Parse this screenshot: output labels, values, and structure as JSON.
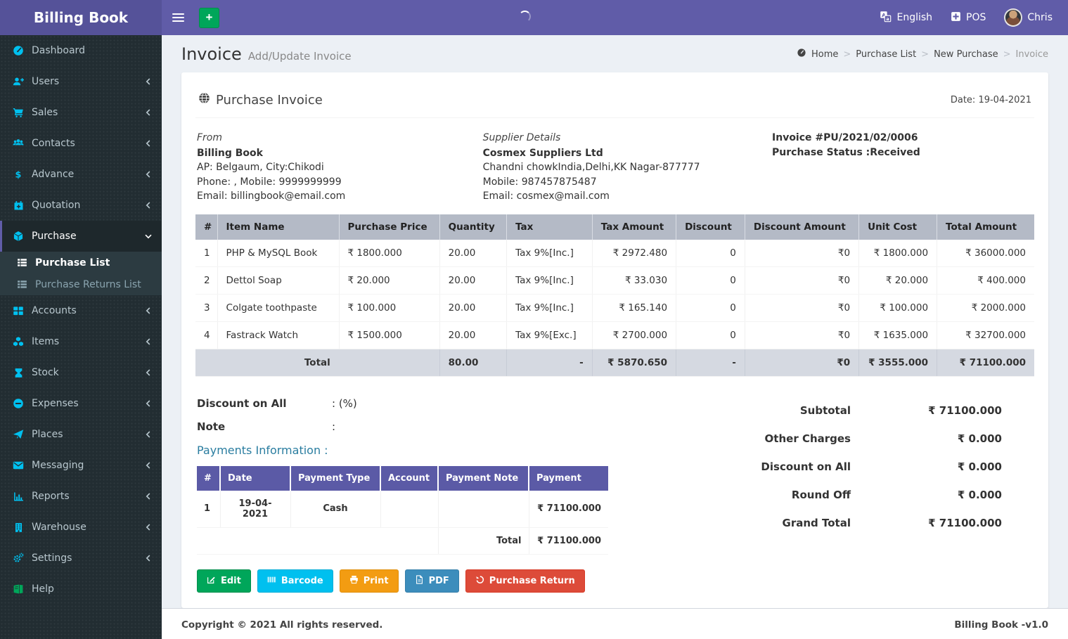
{
  "app": {
    "name": "Billing Book",
    "version": "Billing Book -v1.0",
    "copyright": "Copyright © 2021 All rights reserved."
  },
  "topbar": {
    "add_button": "+",
    "language": "English",
    "pos": "POS",
    "user": "Chris"
  },
  "sidebar": {
    "items": [
      {
        "label": "Dashboard",
        "icon": "dashboard-gauge-icon"
      },
      {
        "label": "Users",
        "icon": "user-plus-icon",
        "chevron": "left"
      },
      {
        "label": "Sales",
        "icon": "cart-icon",
        "chevron": "left"
      },
      {
        "label": "Contacts",
        "icon": "contacts-group-icon",
        "chevron": "left"
      },
      {
        "label": "Advance",
        "icon": "dollar-icon",
        "chevron": "left"
      },
      {
        "label": "Quotation",
        "icon": "calendar-plus-icon",
        "chevron": "left"
      },
      {
        "label": "Purchase",
        "icon": "cube-icon",
        "chevron": "down",
        "active": true
      },
      {
        "label": "Accounts",
        "icon": "grid-icon",
        "chevron": "left"
      },
      {
        "label": "Items",
        "icon": "cubes-icon",
        "chevron": "left"
      },
      {
        "label": "Stock",
        "icon": "hourglass-icon",
        "chevron": "left"
      },
      {
        "label": "Expenses",
        "icon": "minus-circle-icon",
        "chevron": "left"
      },
      {
        "label": "Places",
        "icon": "paper-plane-icon",
        "chevron": "left"
      },
      {
        "label": "Messaging",
        "icon": "envelope-icon",
        "chevron": "left"
      },
      {
        "label": "Reports",
        "icon": "bar-chart-icon",
        "chevron": "left"
      },
      {
        "label": "Warehouse",
        "icon": "building-icon",
        "chevron": "left"
      },
      {
        "label": "Settings",
        "icon": "gears-icon",
        "chevron": "left"
      },
      {
        "label": "Help",
        "icon": "help-books-icon"
      }
    ],
    "purchase_submenu": [
      {
        "label": "Purchase List",
        "icon": "list-icon",
        "active": true
      },
      {
        "label": "Purchase Returns List",
        "icon": "list-icon",
        "active": false
      }
    ]
  },
  "page": {
    "title": "Invoice",
    "subtitle": "Add/Update Invoice",
    "breadcrumb": {
      "separator": ">",
      "items": [
        "Home",
        "Purchase List",
        "New Purchase",
        "Invoice"
      ]
    }
  },
  "invoice": {
    "card_title": "Purchase Invoice",
    "date": "Date: 19-04-2021",
    "from": {
      "heading": "From",
      "name": "Billing Book",
      "address": "AP: Belgaum, City:Chikodi",
      "phone": "Phone: , Mobile: 9999999999",
      "email": "Email: billingbook@email.com"
    },
    "supplier": {
      "heading": "Supplier Details",
      "name": "Cosmex Suppliers Ltd",
      "address": "Chandni chowkIndia,Delhi,KK Nagar-877777",
      "phone": "Mobile: 987457875487",
      "email": "Email: cosmex@mail.com"
    },
    "meta": {
      "number": "Invoice #PU/2021/02/0006",
      "status": "Purchase Status :Received"
    },
    "items_table": {
      "headers": [
        "#",
        "Item Name",
        "Purchase Price",
        "Quantity",
        "Tax",
        "Tax Amount",
        "Discount",
        "Discount Amount",
        "Unit Cost",
        "Total Amount"
      ],
      "rows": [
        [
          "1",
          "PHP & MySQL Book",
          "₹ 1800.000",
          "20.00",
          "Tax 9%[Inc.]",
          "₹ 2972.480",
          "0",
          "₹0",
          "₹ 1800.000",
          "₹ 36000.000"
        ],
        [
          "2",
          "Dettol Soap",
          "₹ 20.000",
          "20.00",
          "Tax 9%[Inc.]",
          "₹ 33.030",
          "0",
          "₹0",
          "₹ 20.000",
          "₹ 400.000"
        ],
        [
          "3",
          "Colgate toothpaste",
          "₹ 100.000",
          "20.00",
          "Tax 9%[Inc.]",
          "₹ 165.140",
          "0",
          "₹0",
          "₹ 100.000",
          "₹ 2000.000"
        ],
        [
          "4",
          "Fastrack Watch",
          "₹ 1500.000",
          "20.00",
          "Tax 9%[Exc.]",
          "₹ 2700.000",
          "0",
          "₹0",
          "₹ 1635.000",
          "₹ 32700.000"
        ]
      ],
      "total_row": [
        "Total",
        "80.00",
        "-",
        "₹ 5870.650",
        "-",
        "₹0",
        "₹ 3555.000",
        "₹ 71100.000"
      ]
    },
    "discount_on_all": {
      "label": "Discount on All",
      "value": ": (%)"
    },
    "note": {
      "label": "Note",
      "value": ":"
    },
    "payments": {
      "title": "Payments Information :",
      "headers": [
        "#",
        "Date",
        "Payment Type",
        "Account",
        "Payment Note",
        "Payment"
      ],
      "rows": [
        [
          "1",
          "19-04-2021",
          "Cash",
          "",
          "",
          "₹ 71100.000"
        ]
      ],
      "total_label": "Total",
      "total_value": "₹ 71100.000"
    },
    "summary": [
      {
        "label": "Subtotal",
        "value": "₹ 71100.000"
      },
      {
        "label": "Other Charges",
        "value": "₹ 0.000"
      },
      {
        "label": "Discount on All",
        "value": "₹ 0.000"
      },
      {
        "label": "Round Off",
        "value": "₹ 0.000"
      },
      {
        "label": "Grand Total",
        "value": "₹ 71100.000"
      }
    ],
    "buttons": [
      {
        "label": "Edit",
        "icon": "edit-icon",
        "color": "#00a65a"
      },
      {
        "label": "Barcode",
        "icon": "barcode-icon",
        "color": "#00c0ef"
      },
      {
        "label": "Print",
        "icon": "print-icon",
        "color": "#f39c12"
      },
      {
        "label": "PDF",
        "icon": "pdf-icon",
        "color": "#3c8dbc"
      },
      {
        "label": "Purchase Return",
        "icon": "undo-icon",
        "color": "#dd4b39"
      }
    ]
  },
  "colors": {
    "topbar": "#605ca8",
    "logo_bg": "#555299",
    "sidebar_bg": "#222d32",
    "sidebar_icon_accent": "#00c0ef",
    "items_table_header": "#b4bac6",
    "payments_table_header": "#5b5aa6",
    "payments_title_text": "#2a7da0",
    "content_bg": "#ecf0f5"
  }
}
